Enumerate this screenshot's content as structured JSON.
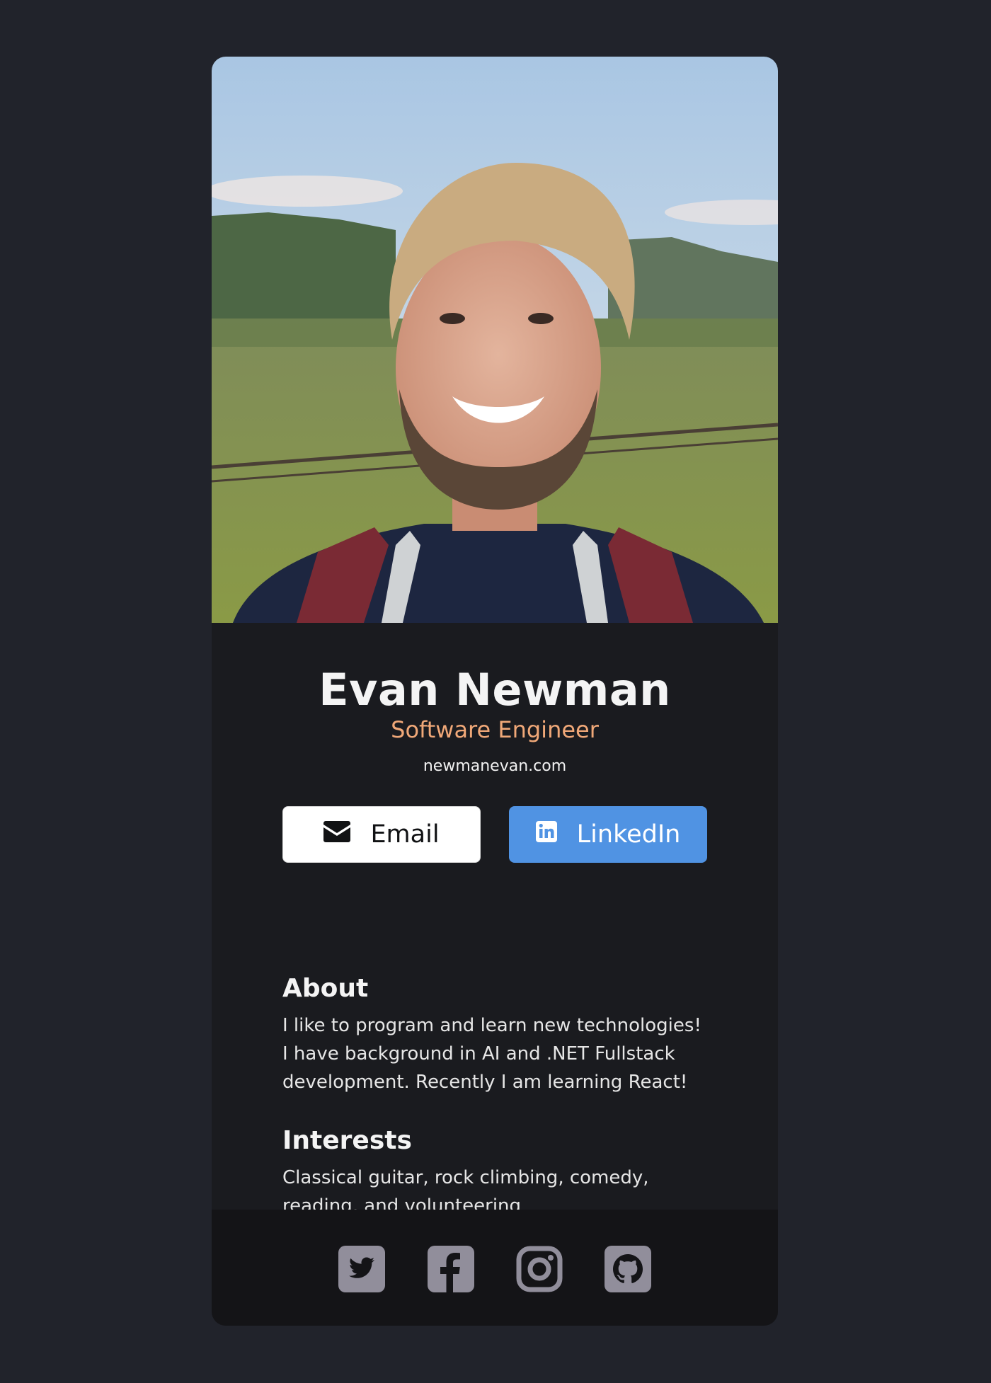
{
  "profile": {
    "name": "Evan Newman",
    "title": "Software Engineer",
    "website": "newmanevan.com",
    "photo_alt": "Evan Newman"
  },
  "buttons": {
    "email_label": "Email",
    "email_icon": "envelope-icon",
    "linkedin_label": "LinkedIn",
    "linkedin_icon": "linkedin-icon"
  },
  "about": {
    "heading": "About",
    "text": "I like to program and learn new technologies! I have background in AI and .NET Fullstack development. Recently I am learning React!"
  },
  "interests": {
    "heading": "Interests",
    "text": "Classical guitar, rock climbing, comedy, reading, and volunteering"
  },
  "footer": {
    "social_icons": [
      "twitter-icon",
      "facebook-icon",
      "instagram-icon",
      "github-icon"
    ]
  },
  "colors": {
    "page_background": "#21232b",
    "card_background": "#1a1b1f",
    "footer_background": "#141417",
    "title_accent": "#f0a878",
    "linkedin_blue": "#5093e3",
    "social_icon_gray": "#918e9b"
  }
}
